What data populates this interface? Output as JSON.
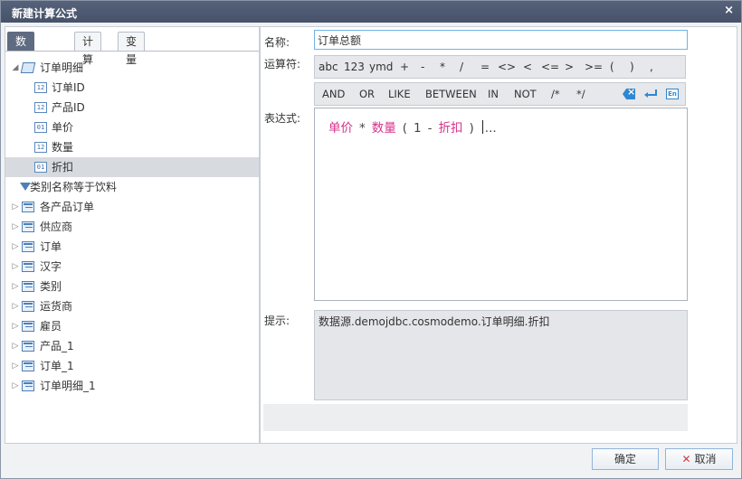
{
  "dialog": {
    "title": "新建计算公式",
    "close_glyph": "×"
  },
  "tabs": [
    "数据目录",
    "计算",
    "变量"
  ],
  "tree": [
    {
      "label": "订单明细",
      "type": "table-open",
      "arrow": "◢",
      "level": 0
    },
    {
      "label": "订单ID",
      "type": "field",
      "badge": "12",
      "level": 1
    },
    {
      "label": "产品ID",
      "type": "field",
      "badge": "12",
      "level": 1
    },
    {
      "label": "单价",
      "type": "field",
      "badge": "01",
      "level": 1
    },
    {
      "label": "数量",
      "type": "field",
      "badge": "12",
      "level": 1
    },
    {
      "label": "折扣",
      "type": "field",
      "badge": "01",
      "level": 1,
      "selected": true
    },
    {
      "label": "类别名称等于饮料",
      "type": "filter",
      "level": 0
    },
    {
      "label": "各产品订单",
      "type": "table",
      "arrow": "▷",
      "level": 0
    },
    {
      "label": "供应商",
      "type": "table",
      "arrow": "▷",
      "level": 0
    },
    {
      "label": "订单",
      "type": "table",
      "arrow": "▷",
      "level": 0
    },
    {
      "label": "汉字",
      "type": "table",
      "arrow": "▷",
      "level": 0
    },
    {
      "label": "类别",
      "type": "table",
      "arrow": "▷",
      "level": 0
    },
    {
      "label": "运货商",
      "type": "table",
      "arrow": "▷",
      "level": 0
    },
    {
      "label": "雇员",
      "type": "table",
      "arrow": "▷",
      "level": 0
    },
    {
      "label": "产品_1",
      "type": "table",
      "arrow": "▷",
      "level": 0
    },
    {
      "label": "订单_1",
      "type": "table",
      "arrow": "▷",
      "level": 0
    },
    {
      "label": "订单明细_1",
      "type": "table",
      "arrow": "▷",
      "level": 0
    }
  ],
  "form": {
    "name_label": "名称:",
    "name_value": "订单总额",
    "operator_label": "运算符:",
    "expression_label": "表达式:",
    "hint_label": "提示:",
    "hint_text": "数据源.demojdbc.cosmodemo.订单明细.折扣"
  },
  "operators": [
    "abc",
    "123",
    "ymd",
    "+",
    "-",
    "*",
    "/",
    "=",
    "<>",
    "<",
    "<=",
    ">",
    ">=",
    "(",
    ")",
    ","
  ],
  "keywords": [
    "AND",
    "OR",
    "LIKE",
    "BETWEEN",
    "IN",
    "NOT",
    "/*",
    "*/"
  ],
  "toolbar_icons": [
    "backspace-icon",
    "enter-icon",
    "en-icon"
  ],
  "en_text": "En",
  "expression": [
    {
      "t": "单价",
      "k": "field"
    },
    {
      "t": "*",
      "k": "op"
    },
    {
      "t": "数量",
      "k": "field"
    },
    {
      "t": "(",
      "k": "op"
    },
    {
      "t": "1",
      "k": "op"
    },
    {
      "t": "-",
      "k": "op"
    },
    {
      "t": "折扣",
      "k": "field"
    },
    {
      "t": ")",
      "k": "op"
    }
  ],
  "expression_trail": "...",
  "buttons": {
    "ok": "确定",
    "cancel": "取消",
    "cancel_glyph": "✕"
  },
  "colors": {
    "field_token": "#d6338a",
    "title_bar": "#4d586f",
    "accent_blue": "#2f87d0"
  }
}
